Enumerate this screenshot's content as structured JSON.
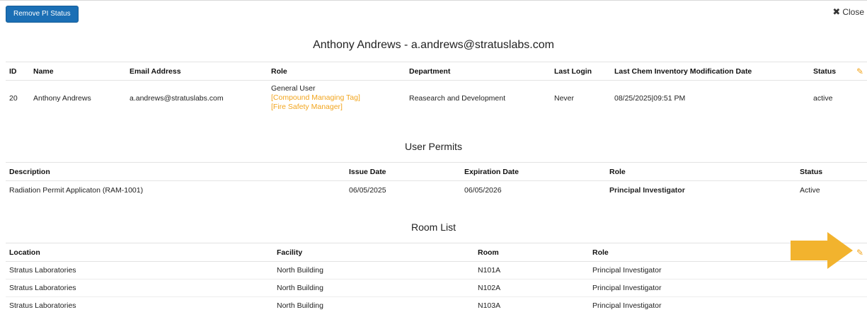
{
  "toolbar": {
    "remove_label": "Remove PI Status",
    "close_label": "Close"
  },
  "user_section": {
    "title": "Anthony Andrews - a.andrews@stratuslabs.com",
    "headers": [
      "ID",
      "Name",
      "Email Address",
      "Role",
      "Department",
      "Last Login",
      "Last Chem Inventory Modification Date",
      "Status"
    ],
    "row": {
      "id": "20",
      "name": "Anthony Andrews",
      "email": "a.andrews@stratuslabs.com",
      "role_main": "General User",
      "role_tag1": "[Compound Managing Tag]",
      "role_tag2": "[Fire Safety Manager]",
      "department": "Reasearch and Development",
      "last_login": "Never",
      "last_mod": "08/25/2025|09:51 PM",
      "status": "active"
    }
  },
  "permits": {
    "title": "User Permits",
    "headers": [
      "Description",
      "Issue Date",
      "Expiration Date",
      "Role",
      "Status"
    ],
    "row": {
      "description": "Radiation Permit Applicaton (RAM-1001)",
      "issue": "06/05/2025",
      "expiration": "06/05/2026",
      "role": "Principal Investigator",
      "status": "Active"
    }
  },
  "rooms": {
    "title": "Room List",
    "headers": [
      "Location",
      "Facility",
      "Room",
      "Role"
    ],
    "rows": [
      {
        "location": "Stratus Laboratories",
        "facility": "North Building",
        "room": "N101A",
        "role": "Principal Investigator"
      },
      {
        "location": "Stratus Laboratories",
        "facility": "North Building",
        "room": "N102A",
        "role": "Principal Investigator"
      },
      {
        "location": "Stratus Laboratories",
        "facility": "North Building",
        "room": "N103A",
        "role": "Principal Investigator"
      }
    ]
  },
  "icons": {
    "edit": "pencil-icon",
    "close": "close-icon",
    "arrow": "arrow-right-icon"
  },
  "colors": {
    "accent": "#f2a51e",
    "button": "#1b6fb5"
  }
}
